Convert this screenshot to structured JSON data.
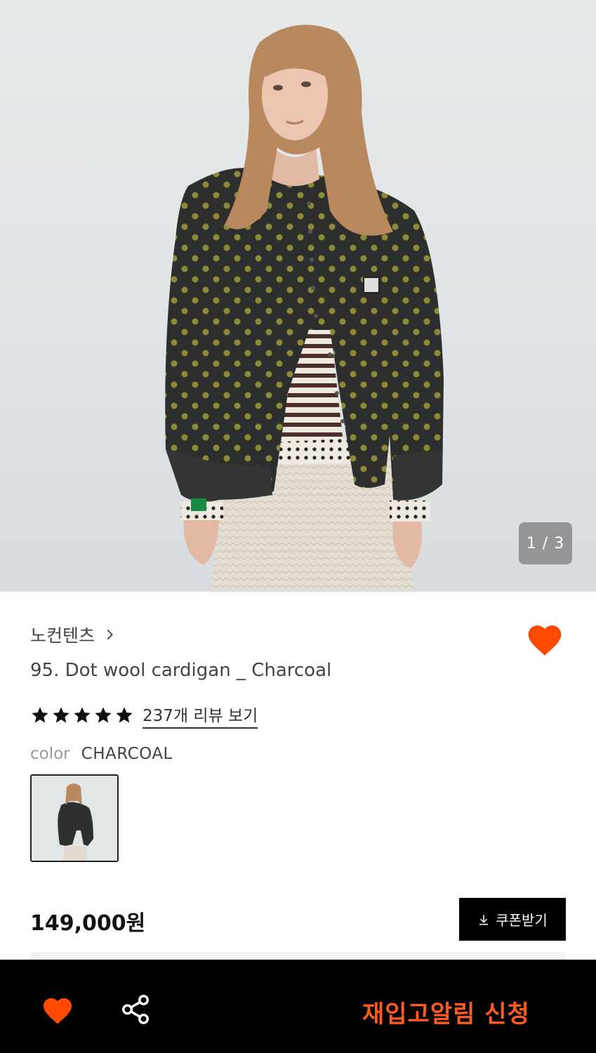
{
  "gallery": {
    "counter": "1 / 3"
  },
  "product": {
    "brand": "노컨텐츠",
    "title": "95. Dot wool cardigan _ Charcoal",
    "rating": 5,
    "review_link": "237개 리뷰 보기",
    "color_label": "color",
    "color_value": "CHARCOAL",
    "price": "149,000원",
    "wishlisted": true
  },
  "actions": {
    "coupon_label": "쿠폰받기",
    "restock_label": "재입고알림 신청"
  },
  "colors": {
    "accent": "#ff4a00",
    "restock_text": "#ff5a1f",
    "button_bg": "#000000",
    "bar_bg": "#000000"
  },
  "icons": [
    "chevron-right-icon",
    "heart-icon",
    "star-icon",
    "download-icon",
    "share-icon"
  ]
}
